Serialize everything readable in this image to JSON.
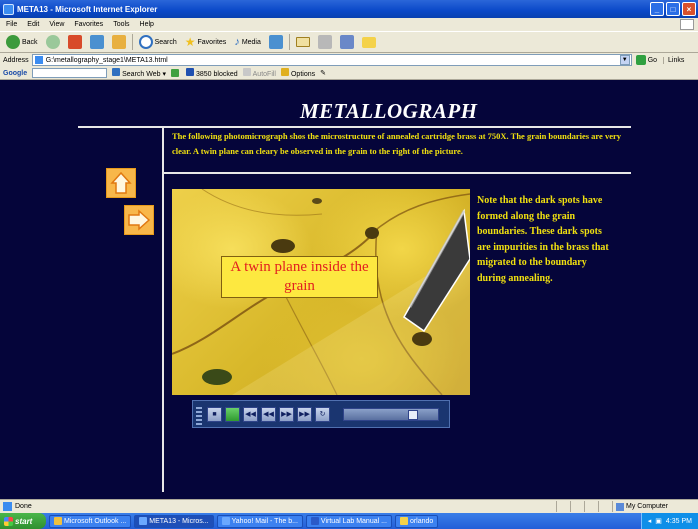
{
  "window": {
    "title": "META13 - Microsoft Internet Explorer",
    "controls": [
      "_",
      "□",
      "×"
    ]
  },
  "menu": [
    "File",
    "Edit",
    "View",
    "Favorites",
    "Tools",
    "Help"
  ],
  "toolbar": {
    "back": "Back",
    "search": "Search",
    "favorites": "Favorites",
    "media": "Media"
  },
  "address": {
    "label": "Address",
    "url": "G:\\metallography_stage1\\META13.html",
    "go": "Go",
    "links": "Links"
  },
  "googlebar": {
    "logo": "Google",
    "search_web": "Search Web",
    "blocked": "3850 blocked",
    "autofill": "AutoFill",
    "options": "Options"
  },
  "page": {
    "title": "METALLOGRAPH",
    "intro": "The following photomicrograph shos the microstructure of annealed cartridge brass at 750X. The grain boundaries are very clear.  A twin plane can cleary be observed in the grain to the right of the picture.",
    "callout": "A twin plane inside the grain",
    "note": "Note that the dark spots have formed along the grain boundaries.  These dark spots are impurities in the brass that migrated to the boundary during annealing.",
    "nav_up_icon": "arrow-up-icon",
    "nav_next_icon": "arrow-right-icon"
  },
  "player": {
    "buttons": [
      "stop",
      "play",
      "rewind",
      "previous",
      "next",
      "fast-forward",
      "loop"
    ],
    "seek_position": 0.78
  },
  "status": {
    "text": "Done",
    "zone": "My Computer"
  },
  "taskbar": {
    "start": "start",
    "tasks": [
      "Microsoft Outlook ...",
      "META13 - Micros...",
      "Yahoo! Mail - The b...",
      "Virtual Lab Manual ...",
      "orlando"
    ],
    "clock": "4:35 PM"
  },
  "colors": {
    "page_bg": "#05053a",
    "text_yellow": "#f0e010",
    "callout_text": "#e21f1f",
    "nav_orange": "#f8b74a"
  }
}
